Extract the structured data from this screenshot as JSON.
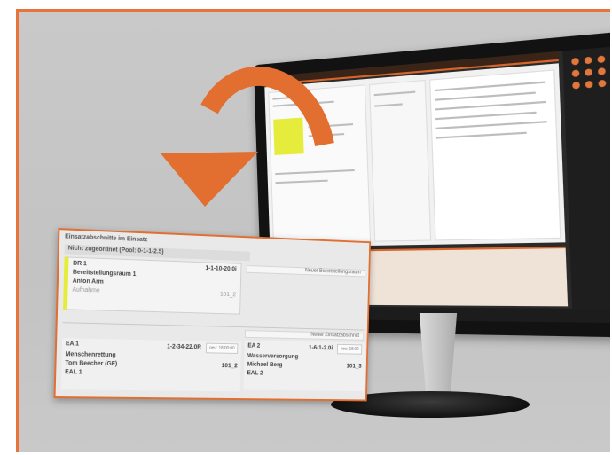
{
  "popup": {
    "title": "Einsatzabschnitte im Einsatz",
    "subtitle": "Nicht zugeordnet (Pool: 0-1-1-2.5)",
    "card_left": {
      "name": "DR 1",
      "code": "1-1-10-20.0i",
      "line2": "Bereitstellungsraum 1",
      "line3": "Anton Arm",
      "status": "Aufnahme",
      "ref": "101_2"
    },
    "right_header_top": "Neuer Bereitstellungsraum",
    "right_header_bottom": "Neuer Einsatzabschnitt",
    "card_bottom_left": {
      "name": "EA 1",
      "code": "1-2-34-22.0R",
      "badge": "neu: 18:00:00",
      "line2": "Menschenrettung",
      "line3": "Tom Beecher (GF)",
      "line4": "EAL 1",
      "ref": "101_2"
    },
    "card_bottom_right": {
      "name": "EA 2",
      "code": "1-6-1-2.0i",
      "badge": "neu: 18:00",
      "line2": "Wasserversorgung",
      "line3": "Michael Berg",
      "line4": "EAL 2",
      "ref": "101_3"
    }
  },
  "colors": {
    "accent": "#e26e2f",
    "highlight": "#e6ec3c",
    "background": "#c6c6c6"
  },
  "icons": {
    "arrow": "curved-arrow-icon"
  }
}
